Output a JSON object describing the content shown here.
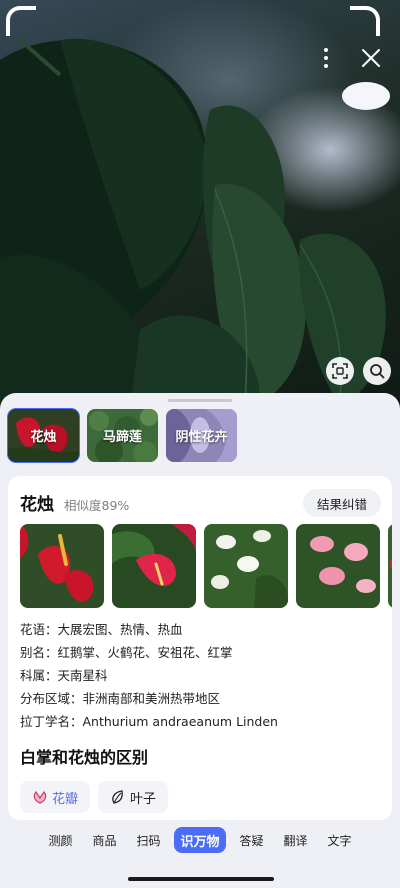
{
  "camera": {
    "more_icon": "more-vertical-icon",
    "close_icon": "close-icon",
    "scan_icon": "scan-frame-icon",
    "search_icon": "search-icon"
  },
  "candidates": [
    {
      "label": "花烛",
      "selected": true
    },
    {
      "label": "马蹄莲",
      "selected": false
    },
    {
      "label": "阴性花卉",
      "selected": false
    }
  ],
  "result": {
    "name": "花烛",
    "similarity": "相似度89%",
    "correct_button": "结果纠错",
    "info": [
      {
        "key": "花语",
        "value": "大展宏图、热情、热血"
      },
      {
        "key": "别名",
        "value": "红鹅掌、火鹤花、安祖花、红掌"
      },
      {
        "key": "科属",
        "value": "天南星科"
      },
      {
        "key": "分布区域",
        "value": "非洲南部和美洲热带地区"
      },
      {
        "key": "拉丁学名",
        "value": "Anthurium andraeanum Linden"
      }
    ],
    "info_lines": [
      "花语：大展宏图、热情、热血",
      "别名：红鹅掌、火鹤花、安祖花、红掌",
      "科属：天南星科",
      "分布区域：非洲南部和美洲热带地区",
      "拉丁学名：Anthurium andraeanum Linden"
    ]
  },
  "difference": {
    "title": "白掌和花烛的区别",
    "tabs": [
      {
        "label": "花瓣",
        "icon": "petal-icon",
        "active": true
      },
      {
        "label": "叶子",
        "icon": "leaf-icon",
        "active": false
      }
    ]
  },
  "modes": [
    "测颜",
    "商品",
    "扫码",
    "识万物",
    "答疑",
    "翻译",
    "文字"
  ],
  "active_mode": "识万物",
  "colors": {
    "accent": "#4a6cf7",
    "active_tab_text": "#5b6ee1"
  }
}
